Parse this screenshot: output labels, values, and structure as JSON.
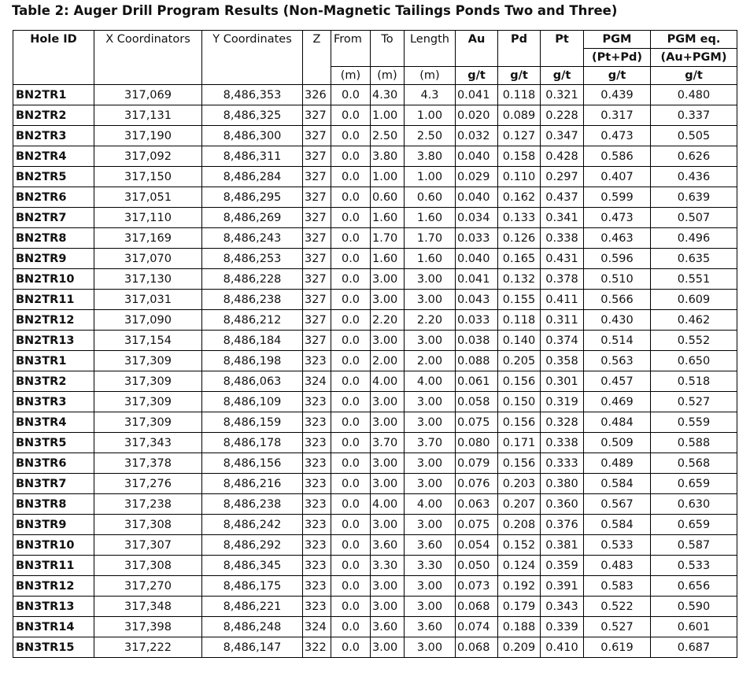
{
  "title": "Table 2: Auger Drill Program Results (Non-Magnetic Tailings Ponds Two and Three)",
  "headers": {
    "hole_id": "Hole ID",
    "x": "X Coordinators",
    "y": "Y Coordinates",
    "z": "Z",
    "from": "From",
    "to": "To",
    "length": "Length",
    "au": "Au",
    "pd": "Pd",
    "pt": "Pt",
    "pgm": "PGM",
    "pgm_sub": "(Pt+Pd)",
    "pgmeq": "PGM eq.",
    "pgmeq_sub": "(Au+PGM)",
    "unit_m": "(m)",
    "unit_gt": "g/t"
  },
  "rows": [
    [
      "BN2TR1",
      "317,069",
      "8,486,353",
      "326",
      "0.0",
      "4.30",
      "4.3",
      "0.041",
      "0.118",
      "0.321",
      "0.439",
      "0.480"
    ],
    [
      "BN2TR2",
      "317,131",
      "8,486,325",
      "327",
      "0.0",
      "1.00",
      "1.00",
      "0.020",
      "0.089",
      "0.228",
      "0.317",
      "0.337"
    ],
    [
      "BN2TR3",
      "317,190",
      "8,486,300",
      "327",
      "0.0",
      "2.50",
      "2.50",
      "0.032",
      "0.127",
      "0.347",
      "0.473",
      "0.505"
    ],
    [
      "BN2TR4",
      "317,092",
      "8,486,311",
      "327",
      "0.0",
      "3.80",
      "3.80",
      "0.040",
      "0.158",
      "0.428",
      "0.586",
      "0.626"
    ],
    [
      "BN2TR5",
      "317,150",
      "8,486,284",
      "327",
      "0.0",
      "1.00",
      "1.00",
      "0.029",
      "0.110",
      "0.297",
      "0.407",
      "0.436"
    ],
    [
      "BN2TR6",
      "317,051",
      "8,486,295",
      "327",
      "0.0",
      "0.60",
      "0.60",
      "0.040",
      "0.162",
      "0.437",
      "0.599",
      "0.639"
    ],
    [
      "BN2TR7",
      "317,110",
      "8,486,269",
      "327",
      "0.0",
      "1.60",
      "1.60",
      "0.034",
      "0.133",
      "0.341",
      "0.473",
      "0.507"
    ],
    [
      "BN2TR8",
      "317,169",
      "8,486,243",
      "327",
      "0.0",
      "1.70",
      "1.70",
      "0.033",
      "0.126",
      "0.338",
      "0.463",
      "0.496"
    ],
    [
      "BN2TR9",
      "317,070",
      "8,486,253",
      "327",
      "0.0",
      "1.60",
      "1.60",
      "0.040",
      "0.165",
      "0.431",
      "0.596",
      "0.635"
    ],
    [
      "BN2TR10",
      "317,130",
      "8,486,228",
      "327",
      "0.0",
      "3.00",
      "3.00",
      "0.041",
      "0.132",
      "0.378",
      "0.510",
      "0.551"
    ],
    [
      "BN2TR11",
      "317,031",
      "8,486,238",
      "327",
      "0.0",
      "3.00",
      "3.00",
      "0.043",
      "0.155",
      "0.411",
      "0.566",
      "0.609"
    ],
    [
      "BN2TR12",
      "317,090",
      "8,486,212",
      "327",
      "0.0",
      "2.20",
      "2.20",
      "0.033",
      "0.118",
      "0.311",
      "0.430",
      "0.462"
    ],
    [
      "BN2TR13",
      "317,154",
      "8,486,184",
      "327",
      "0.0",
      "3.00",
      "3.00",
      "0.038",
      "0.140",
      "0.374",
      "0.514",
      "0.552"
    ],
    [
      "BN3TR1",
      "317,309",
      "8,486,198",
      "323",
      "0.0",
      "2.00",
      "2.00",
      "0.088",
      "0.205",
      "0.358",
      "0.563",
      "0.650"
    ],
    [
      "BN3TR2",
      "317,309",
      "8,486,063",
      "324",
      "0.0",
      "4.00",
      "4.00",
      "0.061",
      "0.156",
      "0.301",
      "0.457",
      "0.518"
    ],
    [
      "BN3TR3",
      "317,309",
      "8,486,109",
      "323",
      "0.0",
      "3.00",
      "3.00",
      "0.058",
      "0.150",
      "0.319",
      "0.469",
      "0.527"
    ],
    [
      "BN3TR4",
      "317,309",
      "8,486,159",
      "323",
      "0.0",
      "3.00",
      "3.00",
      "0.075",
      "0.156",
      "0.328",
      "0.484",
      "0.559"
    ],
    [
      "BN3TR5",
      "317,343",
      "8,486,178",
      "323",
      "0.0",
      "3.70",
      "3.70",
      "0.080",
      "0.171",
      "0.338",
      "0.509",
      "0.588"
    ],
    [
      "BN3TR6",
      "317,378",
      "8,486,156",
      "323",
      "0.0",
      "3.00",
      "3.00",
      "0.079",
      "0.156",
      "0.333",
      "0.489",
      "0.568"
    ],
    [
      "BN3TR7",
      "317,276",
      "8,486,216",
      "323",
      "0.0",
      "3.00",
      "3.00",
      "0.076",
      "0.203",
      "0.380",
      "0.584",
      "0.659"
    ],
    [
      "BN3TR8",
      "317,238",
      "8,486,238",
      "323",
      "0.0",
      "4.00",
      "4.00",
      "0.063",
      "0.207",
      "0.360",
      "0.567",
      "0.630"
    ],
    [
      "BN3TR9",
      "317,308",
      "8,486,242",
      "323",
      "0.0",
      "3.00",
      "3.00",
      "0.075",
      "0.208",
      "0.376",
      "0.584",
      "0.659"
    ],
    [
      "BN3TR10",
      "317,307",
      "8,486,292",
      "323",
      "0.0",
      "3.60",
      "3.60",
      "0.054",
      "0.152",
      "0.381",
      "0.533",
      "0.587"
    ],
    [
      "BN3TR11",
      "317,308",
      "8,486,345",
      "323",
      "0.0",
      "3.30",
      "3.30",
      "0.050",
      "0.124",
      "0.359",
      "0.483",
      "0.533"
    ],
    [
      "BN3TR12",
      "317,270",
      "8,486,175",
      "323",
      "0.0",
      "3.00",
      "3.00",
      "0.073",
      "0.192",
      "0.391",
      "0.583",
      "0.656"
    ],
    [
      "BN3TR13",
      "317,348",
      "8,486,221",
      "323",
      "0.0",
      "3.00",
      "3.00",
      "0.068",
      "0.179",
      "0.343",
      "0.522",
      "0.590"
    ],
    [
      "BN3TR14",
      "317,398",
      "8,486,248",
      "324",
      "0.0",
      "3.60",
      "3.60",
      "0.074",
      "0.188",
      "0.339",
      "0.527",
      "0.601"
    ],
    [
      "BN3TR15",
      "317,222",
      "8,486,147",
      "322",
      "0.0",
      "3.00",
      "3.00",
      "0.068",
      "0.209",
      "0.410",
      "0.619",
      "0.687"
    ]
  ]
}
